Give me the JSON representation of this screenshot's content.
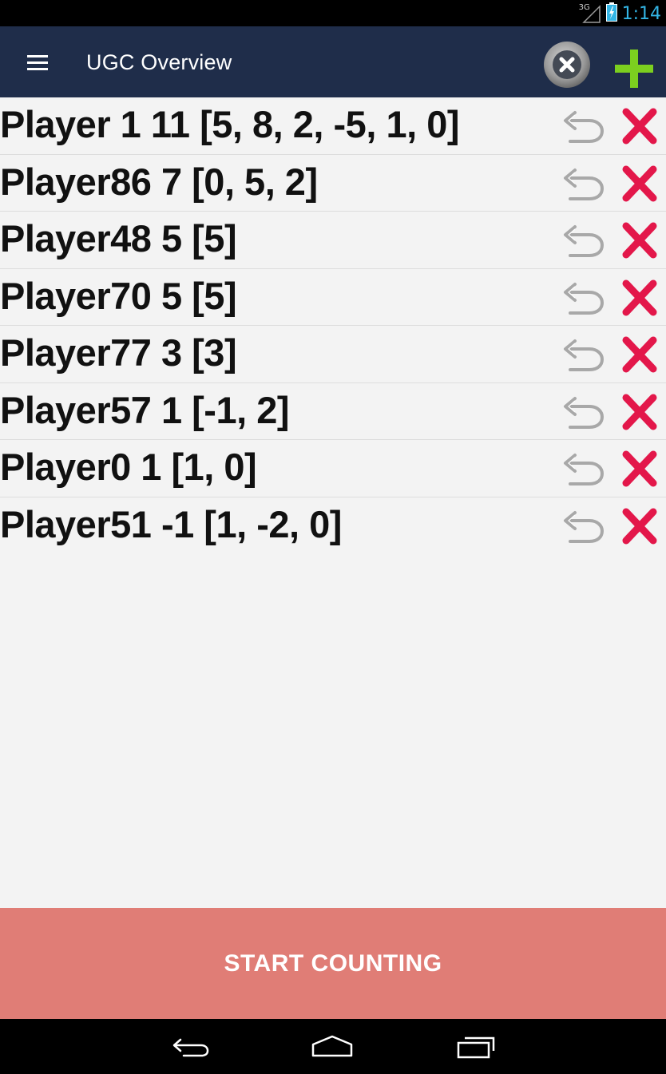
{
  "status_bar": {
    "network": "3G",
    "time": "1:14",
    "time_color": "#33b5e5"
  },
  "action_bar": {
    "title": "UGC Overview",
    "background": "#1f2d4a",
    "icons": [
      "menu-icon",
      "clear-all-icon",
      "add-icon"
    ]
  },
  "players": [
    {
      "label": "Player 1 11 [5, 8, 2, -5, 1, 0]"
    },
    {
      "label": "Player86 7 [0, 5, 2]"
    },
    {
      "label": "Player48 5 [5]"
    },
    {
      "label": "Player70 5 [5]"
    },
    {
      "label": "Player77 3 [3]"
    },
    {
      "label": "Player57 1 [-1, 2]"
    },
    {
      "label": "Player0 1 [1, 0]"
    },
    {
      "label": "Player51 -1 [1, -2, 0]"
    }
  ],
  "row_icons": [
    "undo-icon",
    "delete-icon"
  ],
  "start_button": {
    "label": "START COUNTING",
    "color": "#e07d76"
  },
  "nav_bar": {
    "icons": [
      "back-icon",
      "home-icon",
      "recents-icon"
    ]
  }
}
